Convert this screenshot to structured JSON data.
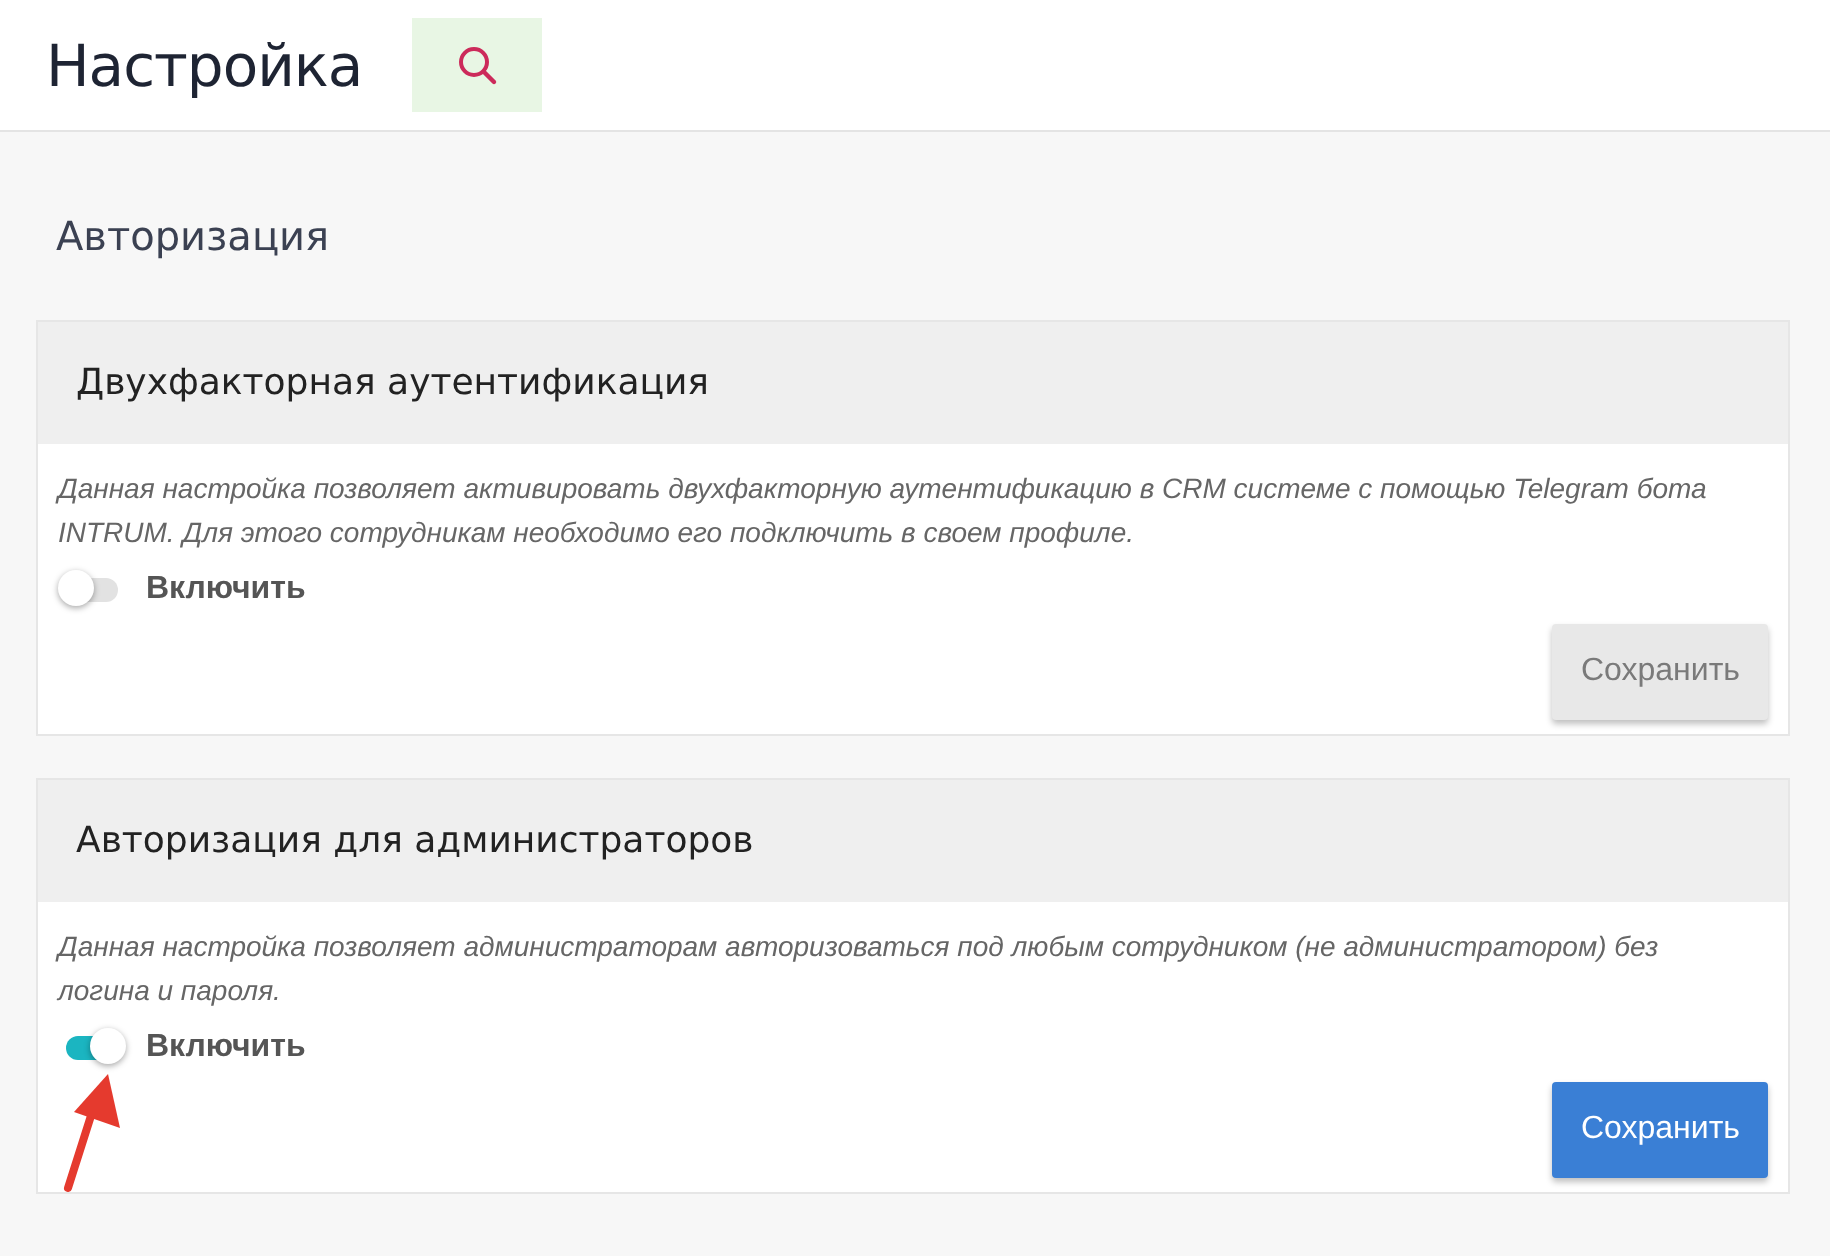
{
  "header": {
    "title": "Настройка"
  },
  "section": {
    "title": "Авторизация"
  },
  "cards": [
    {
      "title": "Двухфакторная аутентификация",
      "description": "Данная настройка позволяет активировать двухфакторную аутентификацию в CRM системе с помощью Telegram бота INTRUM. Для этого сотрудникам необходимо его подключить в своем профиле.",
      "toggle": {
        "label": "Включить",
        "on": false
      },
      "save": {
        "label": "Сохранить",
        "disabled": true
      },
      "pointer_arrow": false
    },
    {
      "title": "Авторизация для администраторов",
      "description": "Данная настройка позволяет администраторам авторизоваться под любым сотрудником (не администратором) без логина и пароля.",
      "toggle": {
        "label": "Включить",
        "on": true
      },
      "save": {
        "label": "Сохранить",
        "disabled": false
      },
      "pointer_arrow": true
    }
  ]
}
